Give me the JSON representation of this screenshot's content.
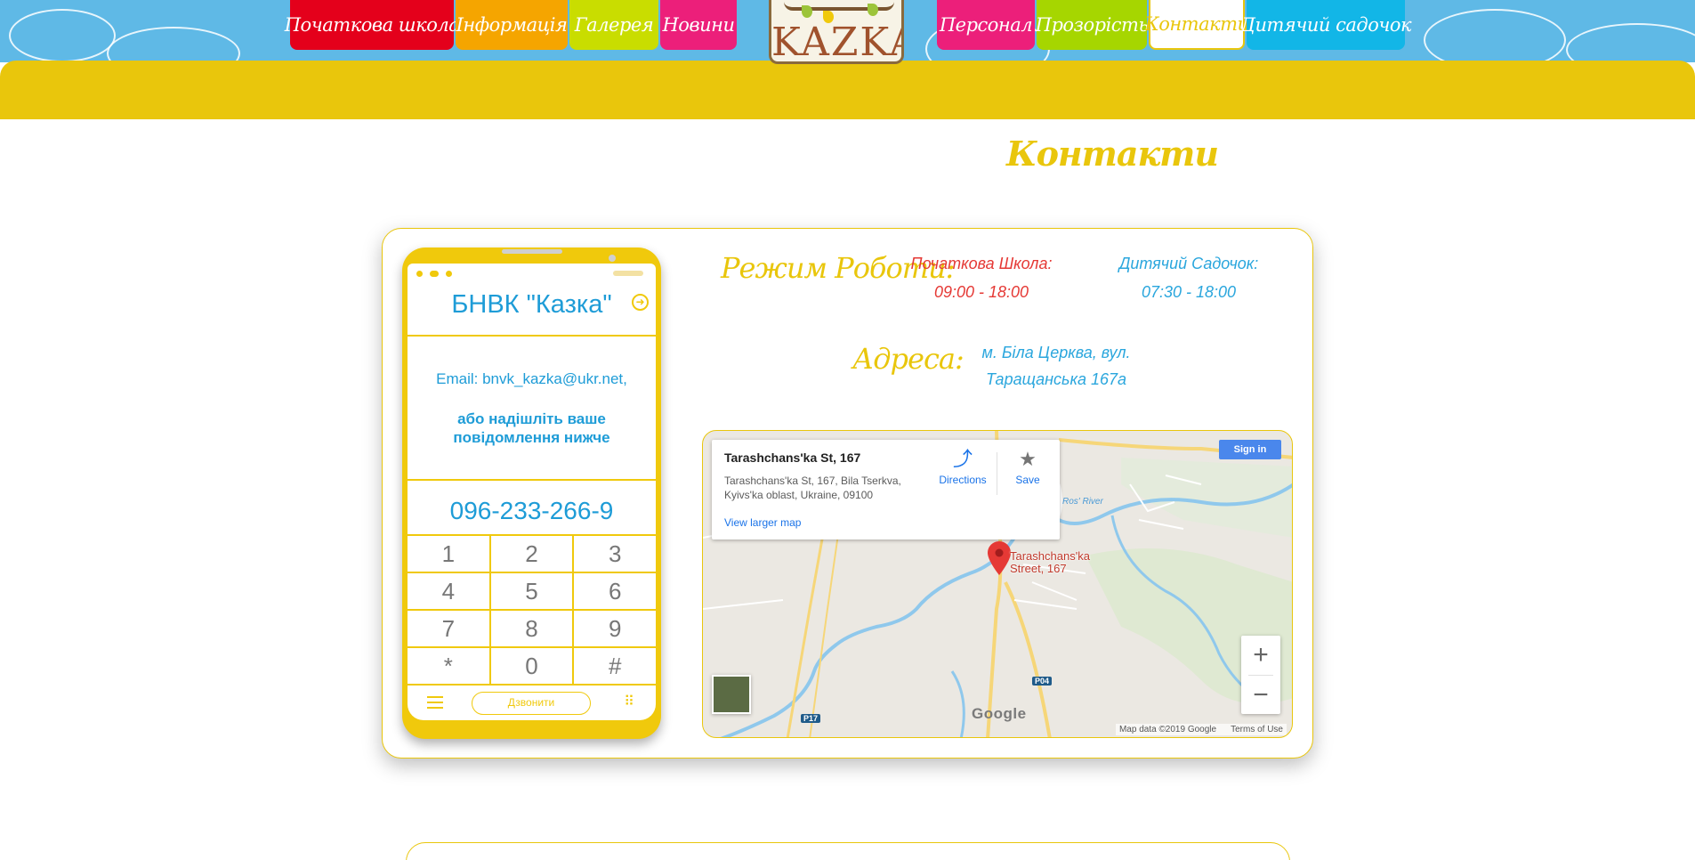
{
  "nav": {
    "items": [
      {
        "label": "Початкова школа",
        "color": "#e4001b"
      },
      {
        "label": "Інформація",
        "color": "#f5a500"
      },
      {
        "label": "Галерея",
        "color": "#c9dd00"
      },
      {
        "label": "Новини",
        "color": "#ec1f7a"
      },
      {
        "label": "Персонал",
        "color": "#ec1f7a"
      },
      {
        "label": "Прозорість",
        "color": "#a6d600"
      },
      {
        "label": "Контакти",
        "color": "#ffffff",
        "active": true
      },
      {
        "label": "Дитячий садочок",
        "color": "#12b6e7"
      }
    ],
    "logo_text": "KAZKA"
  },
  "page_title": "Контакти",
  "phone": {
    "title": "БНВК \"Казка\"",
    "email": "Email: bnvk_kazka@ukr.net,",
    "message": "або надішліть ваше повідомлення нижче",
    "number": "096-233-266-9",
    "keys": [
      [
        "1",
        "2",
        "3"
      ],
      [
        "4",
        "5",
        "6"
      ],
      [
        "7",
        "8",
        "9"
      ],
      [
        "*",
        "0",
        "#"
      ]
    ],
    "call_label": "Дзвонити"
  },
  "schedule": {
    "label": "Режим Роботи:",
    "primary_title": "Початкова Школа:",
    "primary_hours": "09:00 - 18:00",
    "kindergarten_title": "Дитячий Садочок:",
    "kindergarten_hours": "07:30 - 18:00"
  },
  "address": {
    "label": "Адреса:",
    "line1": "м. Біла Церква, вул.",
    "line2": "Таращанська 167а"
  },
  "map": {
    "place_title": "Tarashchans'ka St, 167",
    "place_address": "Tarashchans'ka St, 167, Bila Tserkva, Kyivs'ka oblast, Ukraine, 09100",
    "directions_label": "Directions",
    "save_label": "Save",
    "larger_map_label": "View larger map",
    "signin_label": "Sign in",
    "pin_label_line1": "Tarashchans'ka",
    "pin_label_line2": "Street, 167",
    "river_label": "Ros' River",
    "road_p04": "P04",
    "road_p17": "P17",
    "google_label": "Google",
    "data_label": "Map data ©2019 Google",
    "terms_label": "Terms of Use",
    "zoom_in": "+",
    "zoom_out": "−"
  },
  "colors": {
    "brand_yellow": "#e9c60c",
    "sky_blue": "#5fb9e6",
    "accent_blue": "#1e9cd7",
    "accent_red": "#e53935"
  }
}
